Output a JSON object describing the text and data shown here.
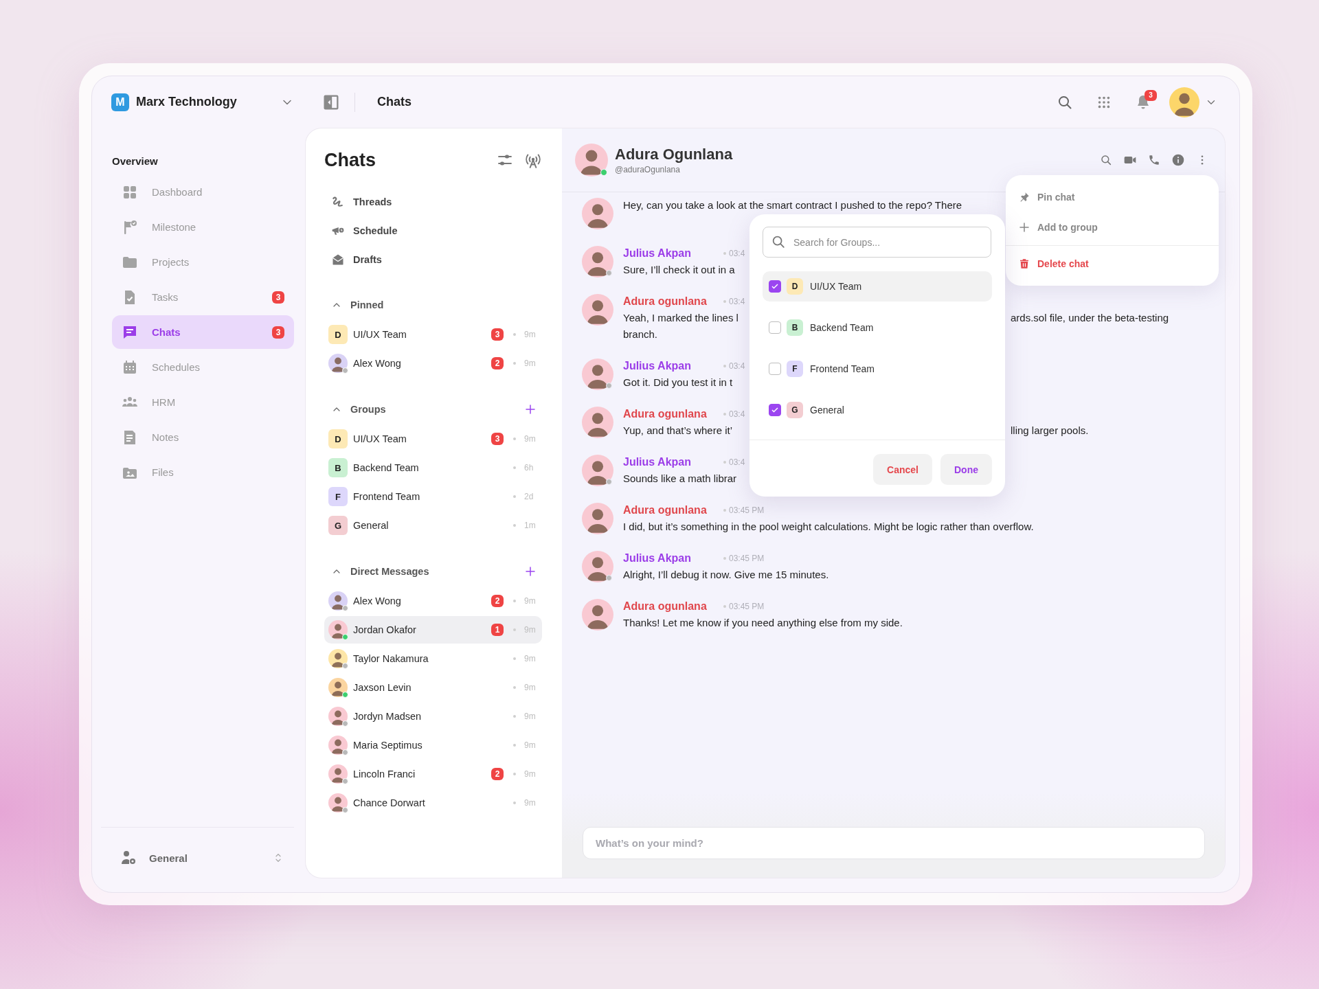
{
  "sidebar": {
    "workspace": {
      "initial": "M",
      "name": "Marx Technology"
    },
    "section": "Overview",
    "items": [
      {
        "label": "Dashboard",
        "selected": false
      },
      {
        "label": "Milestone",
        "selected": false
      },
      {
        "label": "Projects",
        "selected": false
      },
      {
        "label": "Tasks",
        "badge": "3",
        "selected": false
      },
      {
        "label": "Chats",
        "badge": "3",
        "selected": true
      },
      {
        "label": "Schedules",
        "selected": false
      },
      {
        "label": "HRM",
        "selected": false
      },
      {
        "label": "Notes",
        "selected": false
      },
      {
        "label": "Files",
        "selected": false
      }
    ],
    "footer": {
      "label": "General"
    }
  },
  "topbar": {
    "title": "Chats",
    "notifications": "3"
  },
  "chat_list": {
    "title": "Chats",
    "links": [
      {
        "label": "Threads"
      },
      {
        "label": "Schedule"
      },
      {
        "label": "Drafts"
      }
    ],
    "sections": [
      {
        "title": "Pinned",
        "can_add": false,
        "items": [
          {
            "kind": "group",
            "initial": "D",
            "color": "#fde9b5",
            "name": "UI/UX Team",
            "badge": "3",
            "time": "9m",
            "selected": false
          },
          {
            "kind": "person",
            "color": "#d9d2f5",
            "name": "Alex Wong",
            "online": false,
            "badge": "2",
            "time": "9m",
            "selected": false
          }
        ]
      },
      {
        "title": "Groups",
        "can_add": true,
        "items": [
          {
            "kind": "group",
            "initial": "D",
            "color": "#fde9b5",
            "name": "UI/UX Team",
            "badge": "3",
            "time": "9m",
            "selected": false
          },
          {
            "kind": "group",
            "initial": "B",
            "color": "#c9f0d2",
            "name": "Backend Team",
            "time": "6h",
            "selected": false
          },
          {
            "kind": "group",
            "initial": "F",
            "color": "#ddd7fb",
            "name": "Frontend Team",
            "time": "2d",
            "selected": false
          },
          {
            "kind": "group",
            "initial": "G",
            "color": "#f3cdd1",
            "name": "General",
            "time": "1m",
            "selected": false
          }
        ]
      },
      {
        "title": "Direct Messages",
        "can_add": true,
        "items": [
          {
            "kind": "person",
            "color": "#d9d2f5",
            "name": "Alex Wong",
            "online": false,
            "badge": "2",
            "time": "9m",
            "selected": false
          },
          {
            "kind": "person",
            "color": "#f9c9d2",
            "name": "Jordan Okafor",
            "online": true,
            "badge": "1",
            "time": "9m",
            "selected": true
          },
          {
            "kind": "person",
            "color": "#fde6a8",
            "name": "Taylor Nakamura",
            "online": false,
            "time": "9m",
            "selected": false
          },
          {
            "kind": "person",
            "color": "#fbd5a0",
            "name": "Jaxson Levin",
            "online": true,
            "time": "9m",
            "selected": false
          },
          {
            "kind": "person",
            "color": "#f9c9d2",
            "name": "Jordyn Madsen",
            "online": false,
            "time": "9m",
            "selected": false
          },
          {
            "kind": "person",
            "color": "#f9c9d2",
            "name": "Maria Septimus",
            "online": false,
            "time": "9m",
            "selected": false
          },
          {
            "kind": "person",
            "color": "#f9c9d2",
            "name": "Lincoln Franci",
            "online": false,
            "badge": "2",
            "time": "9m",
            "selected": false
          },
          {
            "kind": "person",
            "color": "#f9c9d2",
            "name": "Chance Dorwart",
            "online": false,
            "time": "9m",
            "selected": false
          }
        ]
      }
    ]
  },
  "conversation": {
    "name": "Adura Ogunlana",
    "handle": "@aduraOgunlana",
    "online": true,
    "messages": [
      {
        "presence_dot": false,
        "lines": [
          [
            "Hey, can you take a look at the smart contract I pushed to the repo? There"
          ]
        ]
      },
      {
        "sender": "Julius Akpan",
        "color": "#9b3de8",
        "time": "03:4",
        "presence_dot": true,
        "lines": [
          [
            "Sure, I’ll check it out in a"
          ]
        ]
      },
      {
        "sender": "Adura ogunlana",
        "color": "#e0474c",
        "time": "03:4",
        "presence_dot": false,
        "lines": [
          [
            "Yeah, I marked the lines l",
            "ards.sol file, under the beta-testing"
          ],
          [
            "branch."
          ]
        ]
      },
      {
        "sender": "Julius Akpan",
        "color": "#9b3de8",
        "time": "03:4",
        "presence_dot": true,
        "lines": [
          [
            "Got it. Did you test it in t"
          ]
        ]
      },
      {
        "sender": "Adura ogunlana",
        "color": "#e0474c",
        "time": "03:4",
        "presence_dot": false,
        "lines": [
          [
            "Yup, and that’s where it’",
            "lling larger pools."
          ]
        ]
      },
      {
        "sender": "Julius Akpan",
        "color": "#9b3de8",
        "time": "03:4",
        "presence_dot": true,
        "lines": [
          [
            "Sounds like a math librar"
          ]
        ]
      },
      {
        "sender": "Adura ogunlana",
        "color": "#e0474c",
        "time": "03:45 PM",
        "presence_dot": false,
        "lines": [
          [
            "I did, but it’s something in the pool weight calculations. Might be logic rather than overflow."
          ]
        ]
      },
      {
        "sender": "Julius Akpan",
        "color": "#9b3de8",
        "time": "03:45 PM",
        "presence_dot": true,
        "lines": [
          [
            "Alright, I’ll debug it now. Give me 15 minutes."
          ]
        ]
      },
      {
        "sender": "Adura ogunlana",
        "color": "#e0474c",
        "time": "03:45 PM",
        "presence_dot": false,
        "lines": [
          [
            "Thanks! Let me know if you need anything else from my side."
          ]
        ]
      }
    ],
    "input": {
      "placeholder": "What’s on your mind?"
    }
  },
  "menu": {
    "items": [
      {
        "kind": "normal",
        "label": "Pin chat"
      },
      {
        "kind": "normal",
        "label": "Add to group"
      },
      {
        "kind": "danger",
        "label": "Delete chat"
      }
    ]
  },
  "group_picker": {
    "search": {
      "placeholder": "Search for Groups..."
    },
    "groups": [
      {
        "initial": "D",
        "color": "#fde9b5",
        "name": "UI/UX Team",
        "checked": true,
        "highlighted": true
      },
      {
        "initial": "B",
        "color": "#c9f0d2",
        "name": "Backend Team",
        "checked": false,
        "highlighted": false
      },
      {
        "initial": "F",
        "color": "#ddd7fb",
        "name": "Frontend Team",
        "checked": false,
        "highlighted": false
      },
      {
        "initial": "G",
        "color": "#f3cdd1",
        "name": "General",
        "checked": true,
        "highlighted": false
      }
    ],
    "buttons": [
      {
        "kind": "cancel",
        "label": "Cancel"
      },
      {
        "kind": "done",
        "label": "Done"
      }
    ]
  }
}
